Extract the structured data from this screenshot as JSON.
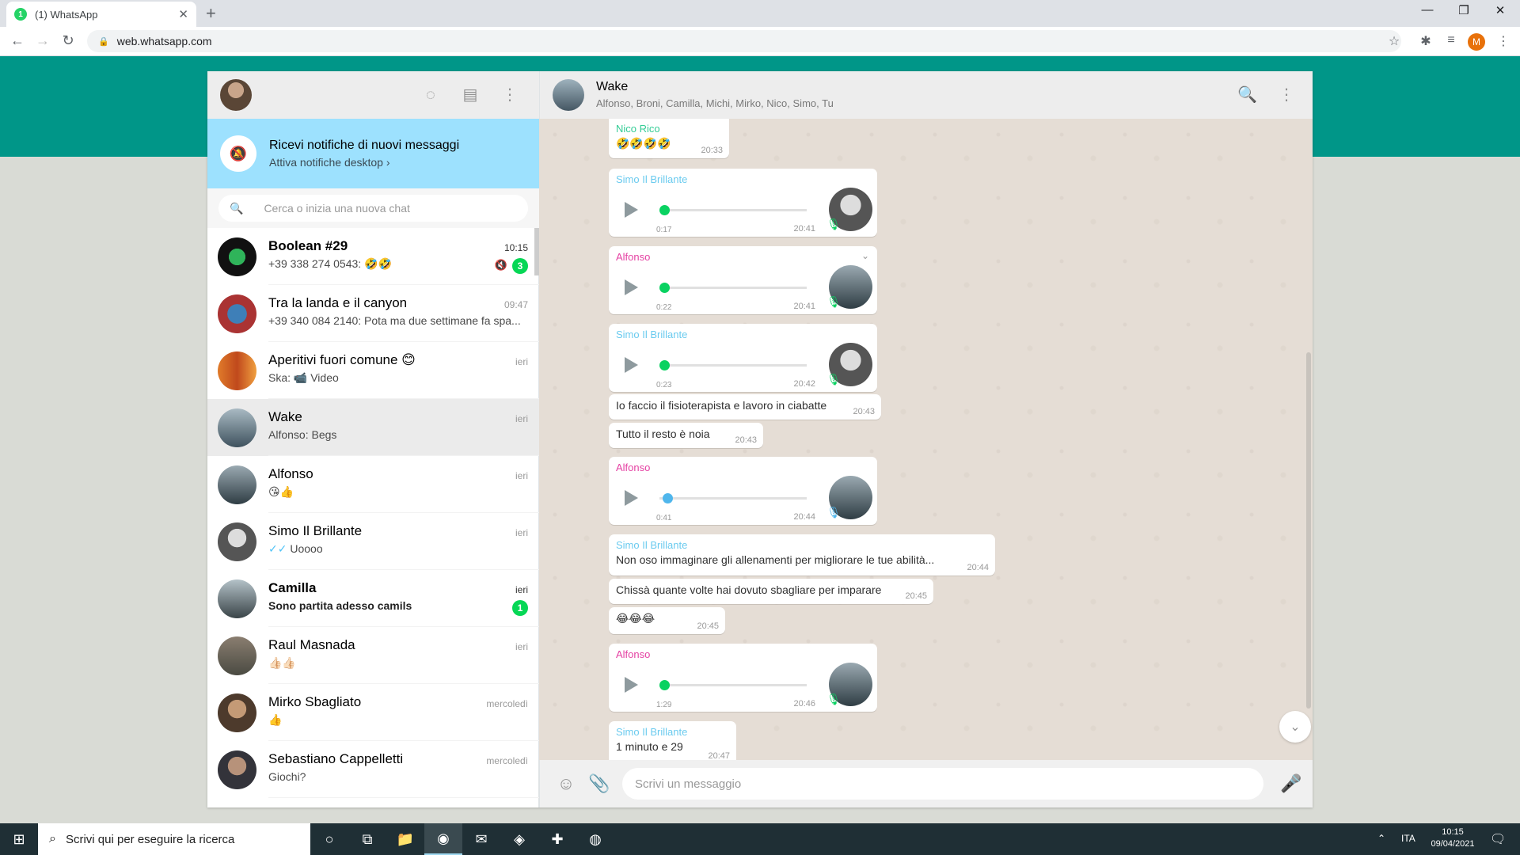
{
  "browser": {
    "tab_title": "(1) WhatsApp",
    "tab_favicon_badge": "1",
    "close_tab": "✕",
    "new_tab": "+",
    "url": "web.whatsapp.com",
    "profile_initial": "M"
  },
  "left_header": {
    "icons": [
      "status-icon",
      "new-chat-icon",
      "menu-icon"
    ]
  },
  "notification": {
    "title": "Ricevi notifiche di nuovi messaggi",
    "subtitle": "Attiva notifiche desktop ›"
  },
  "search": {
    "placeholder": "Cerca o inizia una nuova chat"
  },
  "chats": [
    {
      "name": "Boolean #29",
      "preview": "+39 338 274 0543: 🤣🤣",
      "time": "10:15",
      "badge": "3",
      "muted": true,
      "bold": true
    },
    {
      "name": "Tra la landa e il canyon",
      "preview": "+39 340 084 2140: Pota ma due settimane fa spa...",
      "time": "09:47"
    },
    {
      "name": "Aperitivi fuori comune 😊",
      "preview": "Ska: 📹 Video",
      "time": "ieri"
    },
    {
      "name": "Wake",
      "preview": "Alfonso: Begs",
      "time": "ieri",
      "active": true
    },
    {
      "name": "Alfonso",
      "preview": "😘👍",
      "time": "ieri"
    },
    {
      "name": "Simo Il Brillante",
      "preview_tick": "✓✓",
      "preview": "Uoooo",
      "time": "ieri"
    },
    {
      "name": "Camilla",
      "preview": "Sono partita adesso camils",
      "time": "ieri",
      "badge": "1",
      "bold": true
    },
    {
      "name": "Raul Masnada",
      "preview": "👍🏻👍🏻",
      "time": "ieri"
    },
    {
      "name": "Mirko Sbagliato",
      "preview": "👍",
      "time": "mercoledì"
    },
    {
      "name": "Sebastiano Cappelletti",
      "preview": "Giochi?",
      "time": "mercoledì"
    }
  ],
  "conversation": {
    "name": "Wake",
    "members": "Alfonso, Broni, Camilla, Michi, Mirko, Nico, Simo, Tu",
    "messages": [
      {
        "type": "text",
        "sender": "Nico Rico",
        "text": "🤣🤣🤣🤣",
        "time": "20:33"
      },
      {
        "type": "voice",
        "sender": "Simo Il Brillante",
        "duration": "0:17",
        "time": "20:41"
      },
      {
        "type": "voice",
        "sender": "Alfonso",
        "duration": "0:22",
        "time": "20:41"
      },
      {
        "type": "voice",
        "sender": "Simo Il Brillante",
        "duration": "0:23",
        "time": "20:42"
      },
      {
        "type": "text",
        "text": "Io faccio il fisioterapista e lavoro in ciabatte",
        "time": "20:43"
      },
      {
        "type": "text",
        "text": "Tutto il resto è noia",
        "time": "20:43"
      },
      {
        "type": "voice",
        "sender": "Alfonso",
        "duration": "0:41",
        "time": "20:44"
      },
      {
        "type": "text",
        "sender": "Simo Il Brillante",
        "text": "Non oso immaginare gli allenamenti per migliorare le tue abilità...",
        "time": "20:44"
      },
      {
        "type": "text",
        "text": "Chissà quante volte hai dovuto sbagliare per imparare",
        "time": "20:45"
      },
      {
        "type": "text",
        "text": "😂😂😂",
        "time": "20:45"
      },
      {
        "type": "voice",
        "sender": "Alfonso",
        "duration": "1:29",
        "time": "20:46"
      },
      {
        "type": "text",
        "sender": "Simo Il Brillante",
        "text": "1 minuto e 29",
        "time": "20:47"
      }
    ]
  },
  "composer": {
    "placeholder": "Scrivi un messaggio"
  },
  "taskbar": {
    "search_placeholder": "Scrivi qui per eseguire la ricerca",
    "language": "ITA",
    "time": "10:15",
    "date": "09/04/2021"
  },
  "colors": {
    "accent_green": "#009688",
    "notif_bg": "#9de1fe",
    "badge": "#06d755"
  }
}
